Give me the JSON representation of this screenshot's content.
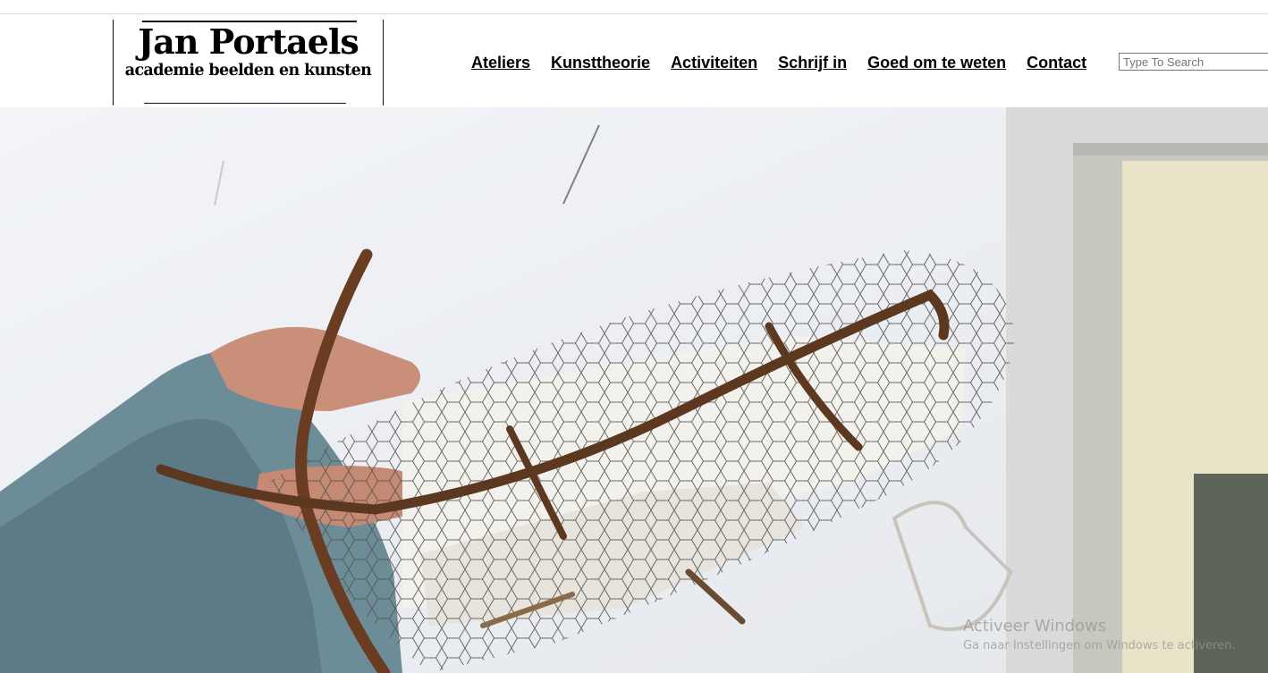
{
  "logo": {
    "title": "Jan Portaels",
    "subtitle": "academie beelden en kunsten"
  },
  "nav": {
    "items": [
      {
        "label": "Ateliers"
      },
      {
        "label": "Kunsttheorie"
      },
      {
        "label": "Activiteiten"
      },
      {
        "label": "Schrijf in"
      },
      {
        "label": "Goed om te weten"
      },
      {
        "label": "Contact"
      }
    ]
  },
  "search": {
    "placeholder": "Type To Search",
    "value": ""
  },
  "hero": {
    "image": "photo of hands shaping a chicken-wire and rebar sculpture armature"
  },
  "watermark": {
    "title": "Activeer Windows",
    "subtitle": "Ga naar Instellingen om Windows te activeren."
  },
  "colors": {
    "text": "#000000",
    "background": "#ffffff",
    "border": "#767676"
  }
}
